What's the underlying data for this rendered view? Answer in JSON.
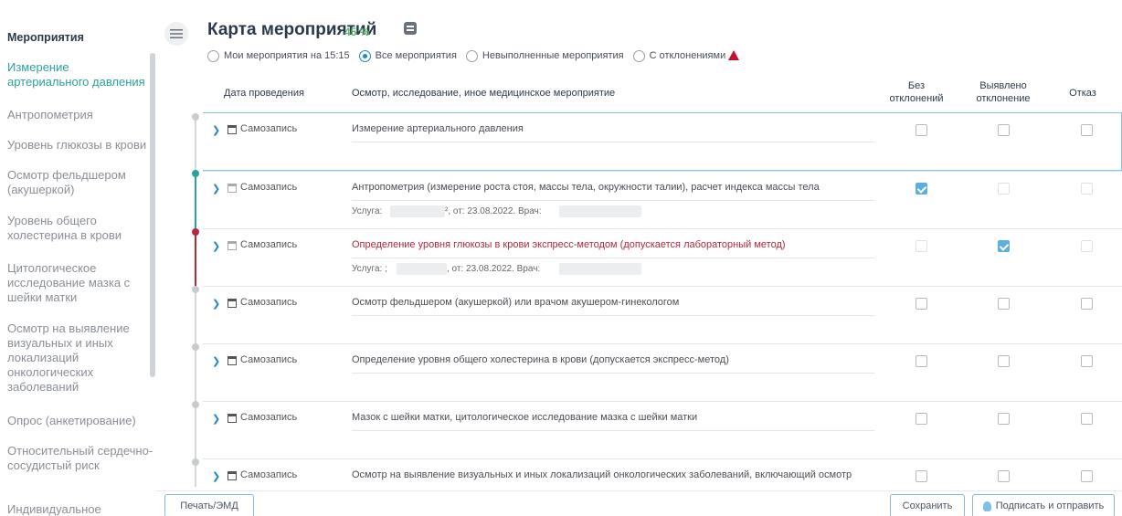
{
  "sidebar": {
    "title": "Мероприятия",
    "items": [
      {
        "label": "Измерение артериального давления",
        "active": true
      },
      {
        "label": "Антропометрия"
      },
      {
        "label": "Уровень глюкозы в крови"
      },
      {
        "label": "Осмотр фельдшером (акушеркой)"
      },
      {
        "label": "Уровень общего холестерина в крови"
      },
      {
        "label": "Цитологическое исследование мазка с шейки матки"
      },
      {
        "label": "Осмотр на выявление визуальных и иных локализаций онкологических заболеваний"
      },
      {
        "label": "Опрос (анкетирование)"
      },
      {
        "label": "Относительный сердечно-сосудистый риск"
      },
      {
        "label": "Индивидуальное"
      }
    ]
  },
  "header": {
    "title": "Карта мероприятий",
    "percent": "45 %"
  },
  "filters": [
    {
      "label": "Мои мероприятия на 15:15",
      "checked": false
    },
    {
      "label": "Все мероприятия",
      "checked": true
    },
    {
      "label": "Невыполненные мероприятия",
      "checked": false
    },
    {
      "label": "С отклонениями",
      "checked": false
    }
  ],
  "table": {
    "col_date": "Дата проведения",
    "col_event": "Осмотр, исследование, иное медицинское мероприятие",
    "col_ok": "Без отклонений",
    "col_dev": "Выявлено отклонение",
    "col_refuse": "Отказ",
    "rows": [
      {
        "source": "Самозапись",
        "name": "Измерение артериального давления"
      },
      {
        "source": "Самозапись",
        "name": "Антропометрия (измерение роста стоя, массы тела, окружности талии), расчет индекса массы тела",
        "service_a": "Услуга:",
        "service_b": "², от: 23.08.2022. Врач:"
      },
      {
        "source": "Самозапись",
        "name": "Определение уровня глюкозы в крови экспресс-методом (допускается лабораторный метод)",
        "service_a": "Услуга: ;",
        "service_b": ", от: 23.08.2022. Врач:"
      },
      {
        "source": "Самозапись",
        "name": "Осмотр фельдшером (акушеркой) или врачом акушером-гинекологом"
      },
      {
        "source": "Самозапись",
        "name": "Определение уровня общего холестерина в крови (допускается экспресс-метод)"
      },
      {
        "source": "Самозапись",
        "name": "Мазок с шейки матки, цитологическое исследование мазка с шейки матки"
      },
      {
        "source": "Самозапись",
        "name": "Осмотр на выявление визуальных и иных локализаций онкологических заболеваний, включающий осмотр"
      }
    ]
  },
  "footer": {
    "print_label": "Печать/ЭМД",
    "save_label": "Сохранить",
    "sign_label": "Подписать и отправить"
  },
  "colors": {
    "accent": "#2aa39a",
    "primary": "#1e88c8",
    "danger": "#b5273a"
  }
}
